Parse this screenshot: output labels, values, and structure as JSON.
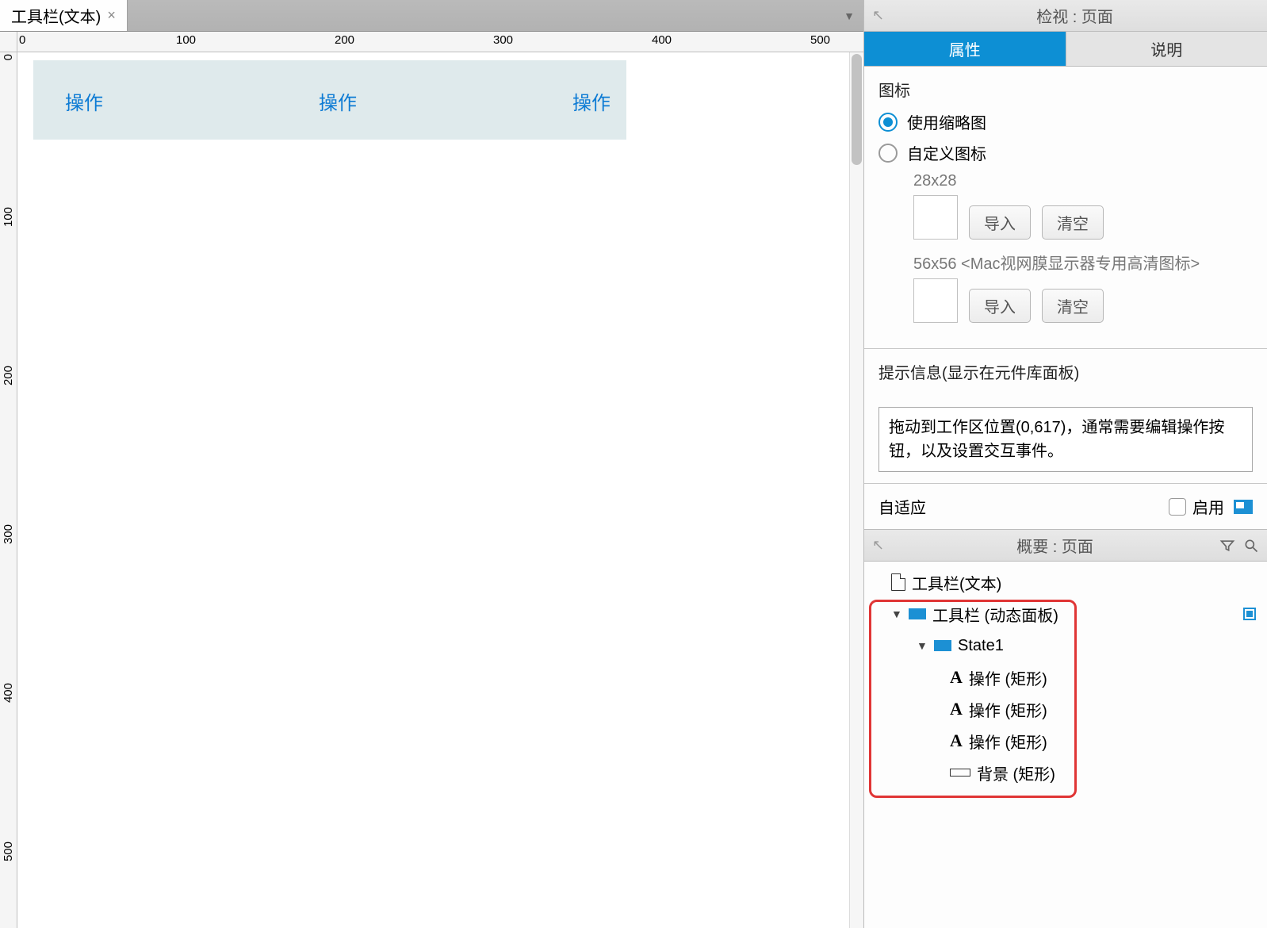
{
  "tabbar": {
    "tab_label": "工具栏(文本)"
  },
  "ruler": {
    "h": [
      "0",
      "100",
      "200",
      "300",
      "400",
      "500"
    ],
    "v": [
      "0",
      "100",
      "200",
      "300",
      "400",
      "500"
    ]
  },
  "canvas": {
    "op1": "操作",
    "op2": "操作",
    "op3": "操作"
  },
  "inspector": {
    "header": "检视 : 页面",
    "tab_props": "属性",
    "tab_desc": "说明",
    "icon_section": "图标",
    "radio_thumbnail": "使用缩略图",
    "radio_custom": "自定义图标",
    "size_28": "28x28",
    "size_56": "56x56 <Mac视网膜显示器专用高清图标>",
    "btn_import": "导入",
    "btn_clear": "清空",
    "hint_header": "提示信息(显示在元件库面板)",
    "hint_text": "拖动到工作区位置(0,617)，通常需要编辑操作按钮，以及设置交互事件。",
    "adaptive": "自适应",
    "enable": "启用"
  },
  "outline": {
    "header": "概要 : 页面",
    "root": "工具栏(文本)",
    "dp": "工具栏 (动态面板)",
    "state": "State1",
    "r1": "操作 (矩形)",
    "r2": "操作 (矩形)",
    "r3": "操作 (矩形)",
    "r4": "背景 (矩形)"
  }
}
